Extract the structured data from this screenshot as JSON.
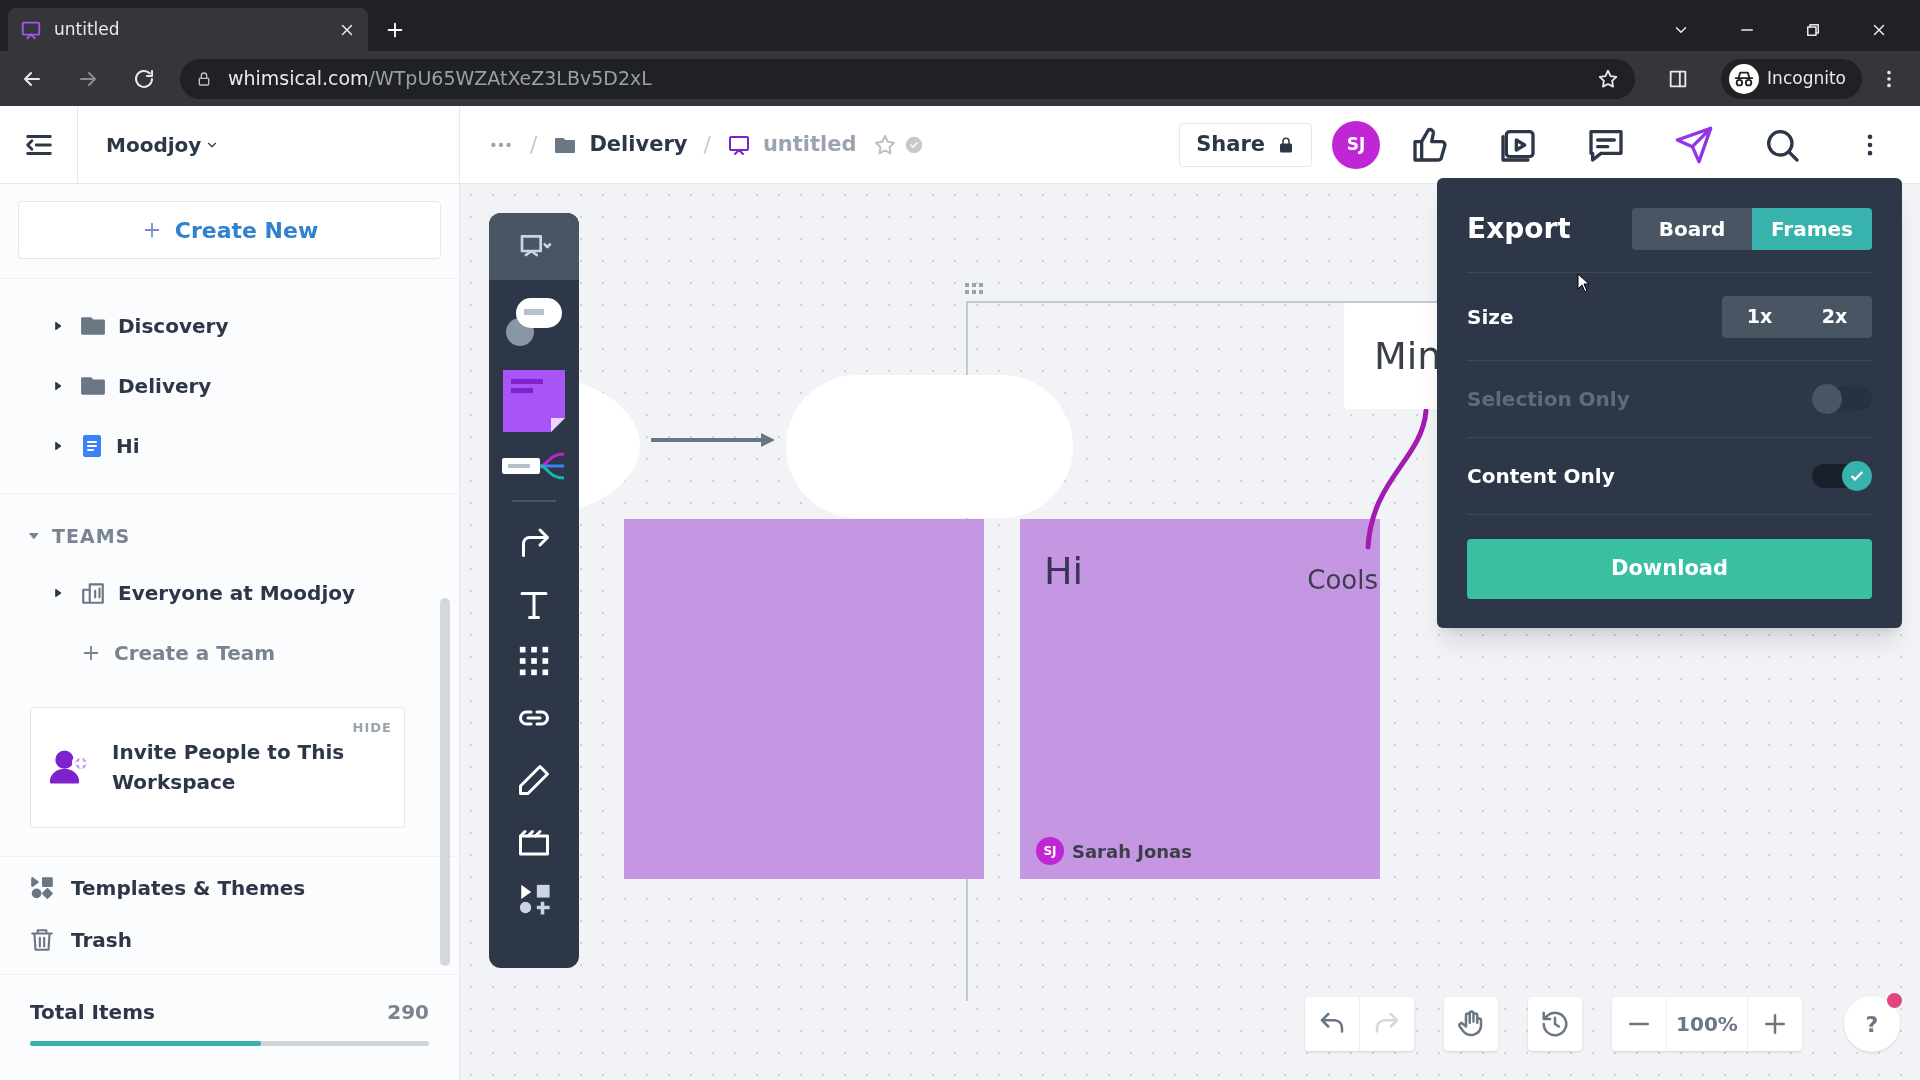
{
  "browser": {
    "tab_title": "untitled",
    "url_host": "whimsical.com",
    "url_path": "/WTpU65WZAtXeZ3LBv5D2xL",
    "profile": "Incognito"
  },
  "header": {
    "workspace": "Moodjoy",
    "breadcrumbs": [
      {
        "separator": "/",
        "label": "Delivery"
      },
      {
        "separator": "/",
        "label": "untitled"
      }
    ],
    "share": "Share",
    "avatar": "SJ"
  },
  "sidebar": {
    "create_new": "Create New",
    "items": [
      {
        "kind": "folder",
        "label": "Discovery"
      },
      {
        "kind": "folder",
        "label": "Delivery"
      },
      {
        "kind": "doc",
        "label": "Hi"
      }
    ],
    "teams": {
      "heading": "TEAMS",
      "expanded": true,
      "items": [
        {
          "label": "Everyone at Moodjoy"
        }
      ],
      "create": "Create a Team"
    },
    "invite": {
      "hide": "HIDE",
      "text": "Invite People to This Workspace"
    },
    "links": [
      {
        "kind": "templates",
        "label": "Templates & Themes"
      },
      {
        "kind": "trash",
        "label": "Trash"
      }
    ],
    "total": {
      "label": "Total Items",
      "count": "290",
      "level": 0.58
    }
  },
  "canvas": {
    "stickies": [
      {
        "text": "Hi",
        "author_initials": "SJ",
        "author": "Sarah Jonas"
      }
    ],
    "card_text": "Min",
    "curve_label": "Cools",
    "zoom": "100%",
    "help": "?"
  },
  "export": {
    "title": "Export",
    "tabs": [
      {
        "label": "Board",
        "selected": false
      },
      {
        "label": "Frames",
        "selected": true
      }
    ],
    "size_label": "Size",
    "sizes": [
      "1x",
      "2x"
    ],
    "options": [
      {
        "label": "Selection Only",
        "on": false,
        "disabled": true
      },
      {
        "label": "Content Only",
        "on": true,
        "disabled": false
      }
    ],
    "download": "Download"
  }
}
